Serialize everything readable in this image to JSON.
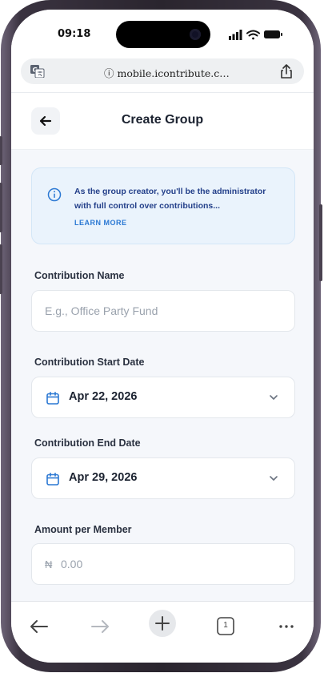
{
  "status_bar": {
    "time": "09:18",
    "icons": [
      "signal-icon",
      "wifi-icon",
      "battery-icon"
    ]
  },
  "browser": {
    "url_display": "ⓘ mobile.icontribute.c…",
    "icons": [
      "translate-icon",
      "share-icon"
    ],
    "toolbar": {
      "tab_count": "1",
      "icons": [
        "back-arrow-icon",
        "forward-arrow-icon",
        "new-tab-plus-icon",
        "tabs-icon",
        "more-dots-icon"
      ]
    }
  },
  "header": {
    "title": "Create Group",
    "back_icon": "arrow-left-icon"
  },
  "info_card": {
    "message": "As the group creator, you'll be the administrator with full control over contributions...",
    "link_label": "LEARN MORE",
    "icon": "info-circle-icon"
  },
  "form": {
    "name": {
      "label": "Contribution Name",
      "placeholder": "E.g., Office Party Fund",
      "value": ""
    },
    "start_date": {
      "label": "Contribution Start Date",
      "value": "Apr 22, 2026",
      "icon": "calendar-icon"
    },
    "end_date": {
      "label": "Contribution End Date",
      "value": "Apr 29, 2026",
      "icon": "calendar-icon"
    },
    "amount": {
      "label": "Amount per Member",
      "currency_symbol": "₦",
      "placeholder": "0.00"
    }
  },
  "colors": {
    "accent": "#2b78d3",
    "info_bg": "#eaf3fc",
    "info_text": "#24408a",
    "app_bg": "#f5f7fb",
    "title_text": "#1b2230"
  }
}
